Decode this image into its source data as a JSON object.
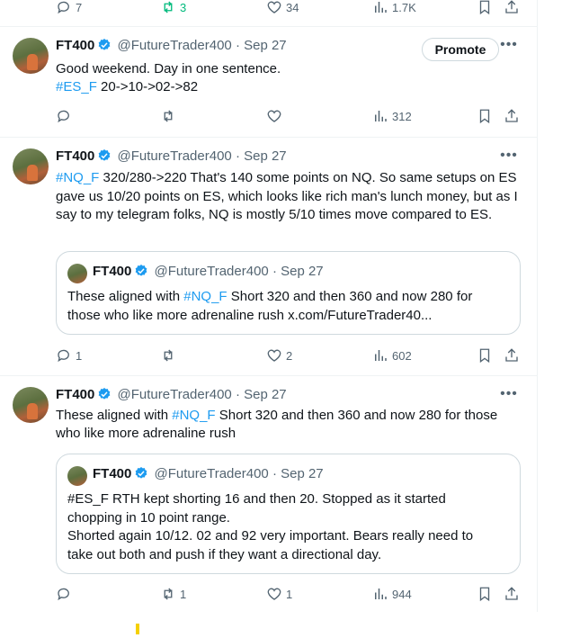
{
  "top_actions": {
    "replies": "7",
    "retweets": "3",
    "likes": "34",
    "views": "1.7K"
  },
  "tweets": [
    {
      "name": "FT400",
      "handle": "@FutureTrader400",
      "date": "· Sep 27",
      "promote_label": "Promote",
      "line1": "Good weekend. Day in one sentence.",
      "tag": "#ES_F",
      "line2_rest": " 20->10->02->82",
      "views": "312"
    },
    {
      "name": "FT400",
      "handle": "@FutureTrader400",
      "date": "· Sep 27",
      "tag": "#NQ_F",
      "text_rest": " 320/280->220 That's 140 some points on NQ. So same setups on ES gave us 10/20 points on ES, which looks like rich man's lunch money, but as I say to my telegram folks, NQ is mostly 5/10 times move compared to ES.",
      "quote": {
        "name": "FT400",
        "handle": "@FutureTrader400",
        "date": "· Sep 27",
        "text_pre": "These aligned with ",
        "tag": "#NQ_F",
        "text_rest": " Short 320 and then 360 and now 280 for those who like more adrenaline rush x.com/FutureTrader40..."
      },
      "replies": "1",
      "likes": "2",
      "views": "602"
    },
    {
      "name": "FT400",
      "handle": "@FutureTrader400",
      "date": "· Sep 27",
      "text_pre": "These aligned with ",
      "tag": "#NQ_F",
      "text_rest": " Short 320 and then 360 and now 280 for those who like more adrenaline rush",
      "quote": {
        "name": "FT400",
        "handle": "@FutureTrader400",
        "date": "· Sep 27",
        "lines": [
          "#ES_F RTH kept shorting 16 and then 20.  Stopped as it started",
          "chopping in 10 point range.",
          "Shorted again 10/12.  02 and 92 very important. Bears really need to",
          "take out both and push if they want a directional day."
        ]
      },
      "retweets": "1",
      "likes": "1",
      "views": "944"
    }
  ],
  "colors": {
    "accent": "#1d9bf0",
    "retweet_green": "#00ba7c",
    "muted": "#536471"
  }
}
